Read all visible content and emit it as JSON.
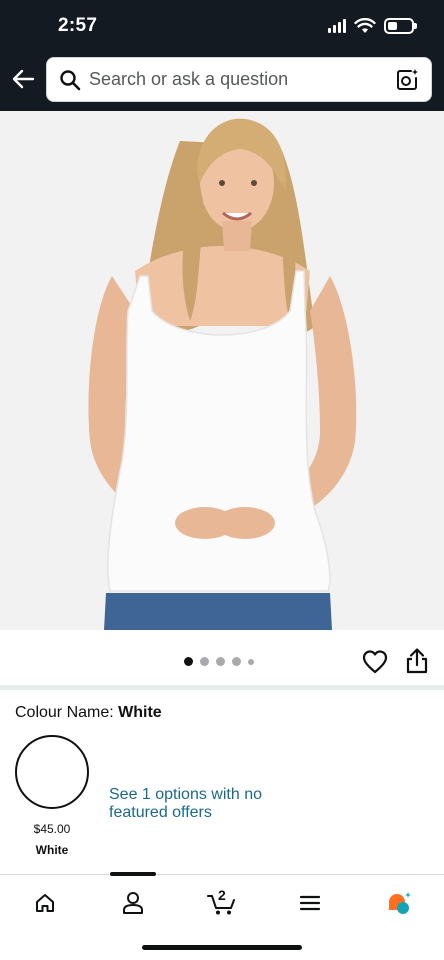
{
  "status_bar": {
    "time": "2:57",
    "icons": [
      "cellular-signal-icon",
      "wifi-icon",
      "battery-icon"
    ],
    "battery_level": 0.4
  },
  "header": {
    "back_icon": "arrow-left-icon",
    "search": {
      "placeholder": "Search or ask a question",
      "value": "",
      "search_icon": "magnifier-icon",
      "camera_icon": "camera-sparkle-icon"
    },
    "background_color": "#131a22"
  },
  "product": {
    "image_description_icon": "product-photo",
    "gallery": {
      "total_images": 5,
      "active_index": 0
    },
    "actions": {
      "wishlist_icon": "heart-outline-icon",
      "share_icon": "share-icon"
    }
  },
  "colour_section": {
    "label_prefix": "Colour Name:",
    "selected_colour": "White",
    "swatches": [
      {
        "name": "White",
        "price": "$45.00",
        "color": "#ffffff"
      }
    ],
    "offers_link": "See 1 options with no featured offers",
    "link_color": "#1a6a8a"
  },
  "bottom_nav": {
    "items": [
      {
        "icon": "home-icon",
        "active": false
      },
      {
        "icon": "user-icon",
        "active": true
      },
      {
        "icon": "cart-icon",
        "active": false,
        "count": "2"
      },
      {
        "icon": "menu-icon",
        "active": false
      },
      {
        "icon": "rufus-assistant-icon",
        "active": false
      }
    ]
  }
}
